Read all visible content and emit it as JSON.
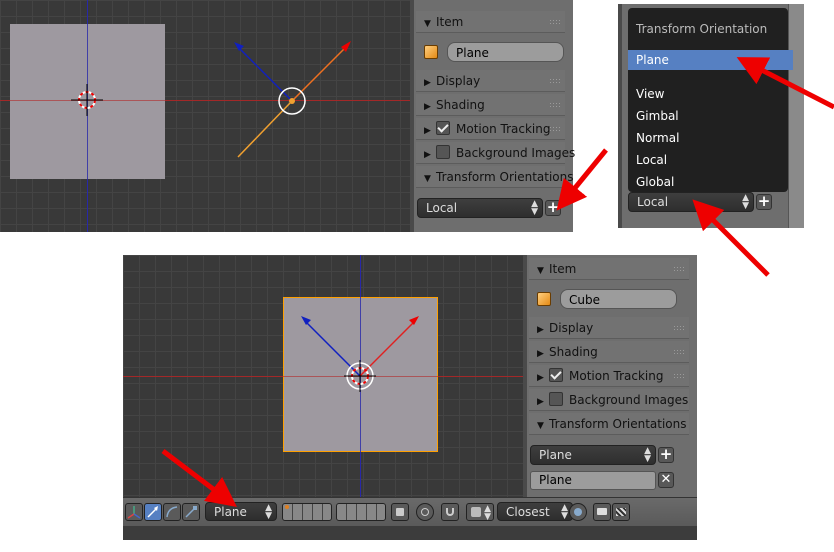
{
  "colors": {
    "viewport_bg": "#393939",
    "panel_bg": "#6e6e6e",
    "selection_blue": "#5680c2",
    "arrow_red": "#ff0000",
    "object_outline": "#ffa000"
  },
  "top_panel": {
    "item_header": "Item",
    "object_name": "Plane",
    "display": "Display",
    "shading": "Shading",
    "motion_tracking": "Motion Tracking",
    "background_images": "Background Images",
    "transform_orientations": "Transform Orientations",
    "orientation_value": "Local",
    "add_icon": "plus-icon"
  },
  "menu_crop": {
    "title": "Transform Orientation",
    "items": [
      "Plane",
      "View",
      "Gimbal",
      "Normal",
      "Local",
      "Global"
    ],
    "selected": "Plane",
    "dropdown_value": "Local",
    "bg_partial": [
      "Plane",
      "Display",
      "Shading",
      "Motion Tracking",
      "Background Images",
      "Transform Orientations"
    ]
  },
  "bottom_panel": {
    "item_header": "Item",
    "object_name": "Cube",
    "display": "Display",
    "shading": "Shading",
    "motion_tracking": "Motion Tracking",
    "background_images": "Background Images",
    "transform_orientations": "Transform Orientations",
    "orientation_value": "Plane",
    "custom_name": "Plane"
  },
  "toolbar": {
    "orientation_value": "Plane",
    "snap_value": "Closest"
  },
  "icons": {
    "cube": "cube-icon",
    "plus": "plus-icon",
    "close": "close-icon",
    "render": "camera-icon",
    "anim": "clapperboard-icon"
  }
}
